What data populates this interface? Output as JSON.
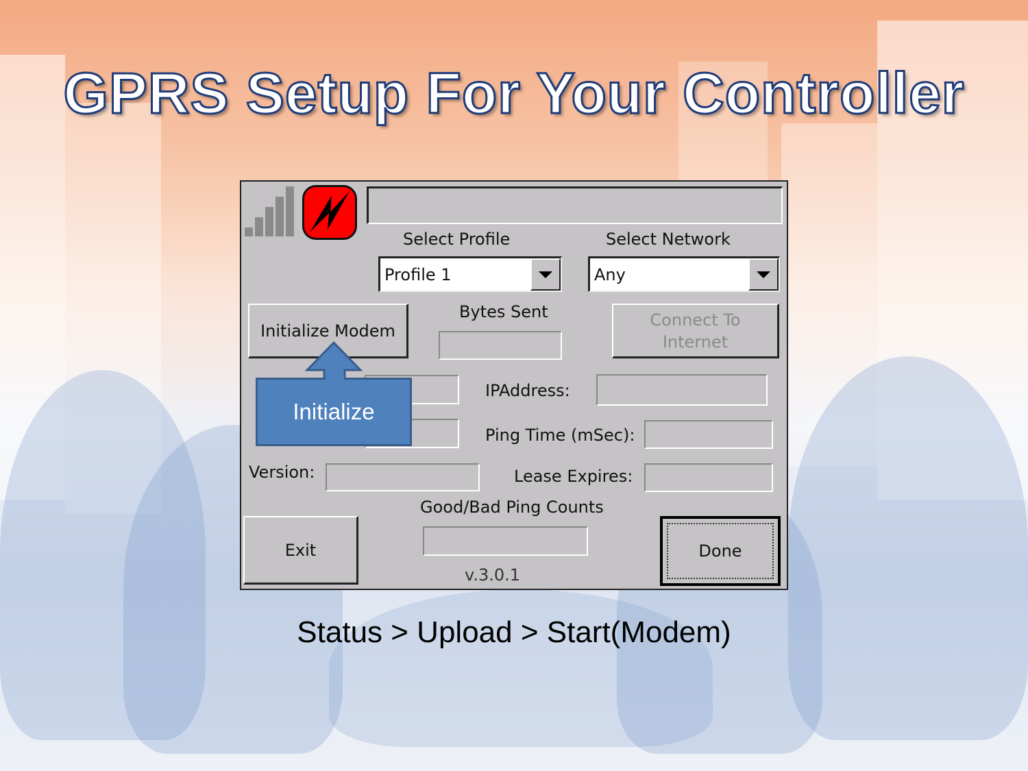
{
  "slide": {
    "title": "GPRS Setup For Your Controller",
    "caption": "Status > Upload > Start(Modem)"
  },
  "dialog": {
    "status_text": "",
    "select_profile_label": "Select Profile",
    "profile_value": "Profile 1",
    "select_network_label": "Select Network",
    "network_value": "Any",
    "initialize_modem_button": "Initialize Modem",
    "bytes_sent_label": "Bytes Sent",
    "connect_button": "Connect To Internet",
    "ip_address_label": "IPAddress:",
    "ping_time_label": "Ping Time (mSec):",
    "version_label": "Version:",
    "lease_expires_label": "Lease Expires:",
    "ping_counts_label": "Good/Bad Ping Counts",
    "exit_button": "Exit",
    "done_button": "Done",
    "version_text": "v.3.0.1"
  },
  "callout": {
    "text": "Initialize",
    "color": "#4f81bd"
  },
  "colors": {
    "dialog_bg": "#c6c3c6",
    "error_icon": "#ff0000"
  },
  "icons": {
    "signal": "signal-strength-icon",
    "status": "disconnected-lightning-icon"
  }
}
